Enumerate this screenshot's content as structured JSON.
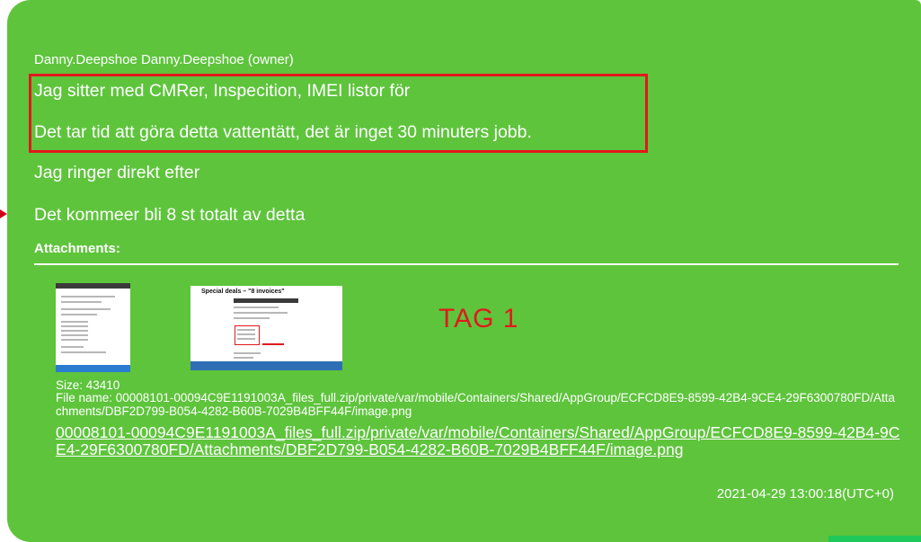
{
  "message": {
    "sender": "Danny.Deepshoe Danny.Deepshoe (owner)",
    "lines": [
      "Jag sitter med CMRer, Inspecition, IMEI listor för",
      "Det tar tid att göra detta vattentätt, det är inget 30 minuters jobb.",
      "Jag ringer direkt efter",
      "Det kommeer bli 8 st totalt av detta"
    ],
    "attachments_label": "Attachments:",
    "thumbnail_2_title": "Special deals – \"8 invoices\"",
    "tag_label": "TAG 1",
    "size_text": "Size: 43410",
    "file_name_text": "File name: 00008101-00094C9E1191003A_files_full.zip/private/var/mobile/Containers/Shared/AppGroup/ECFCD8E9-8599-42B4-9CE4-29F6300780FD/Attachments/DBF2D799-B054-4282-B60B-7029B4BFF44F/image.png",
    "file_link": "00008101-00094C9E1191003A_files_full.zip/private/var/mobile/Containers/Shared/AppGroup/ECFCD8E9-8599-42B4-9CE4-29F6300780FD/Attachments/DBF2D799-B054-4282-B60B-7029B4BFF44F/image.png",
    "timestamp": "2021-04-29 13:00:18(UTC+0)"
  },
  "colors": {
    "bubble": "#5ec43c",
    "highlight": "#e0191c",
    "text": "#ffffff"
  }
}
